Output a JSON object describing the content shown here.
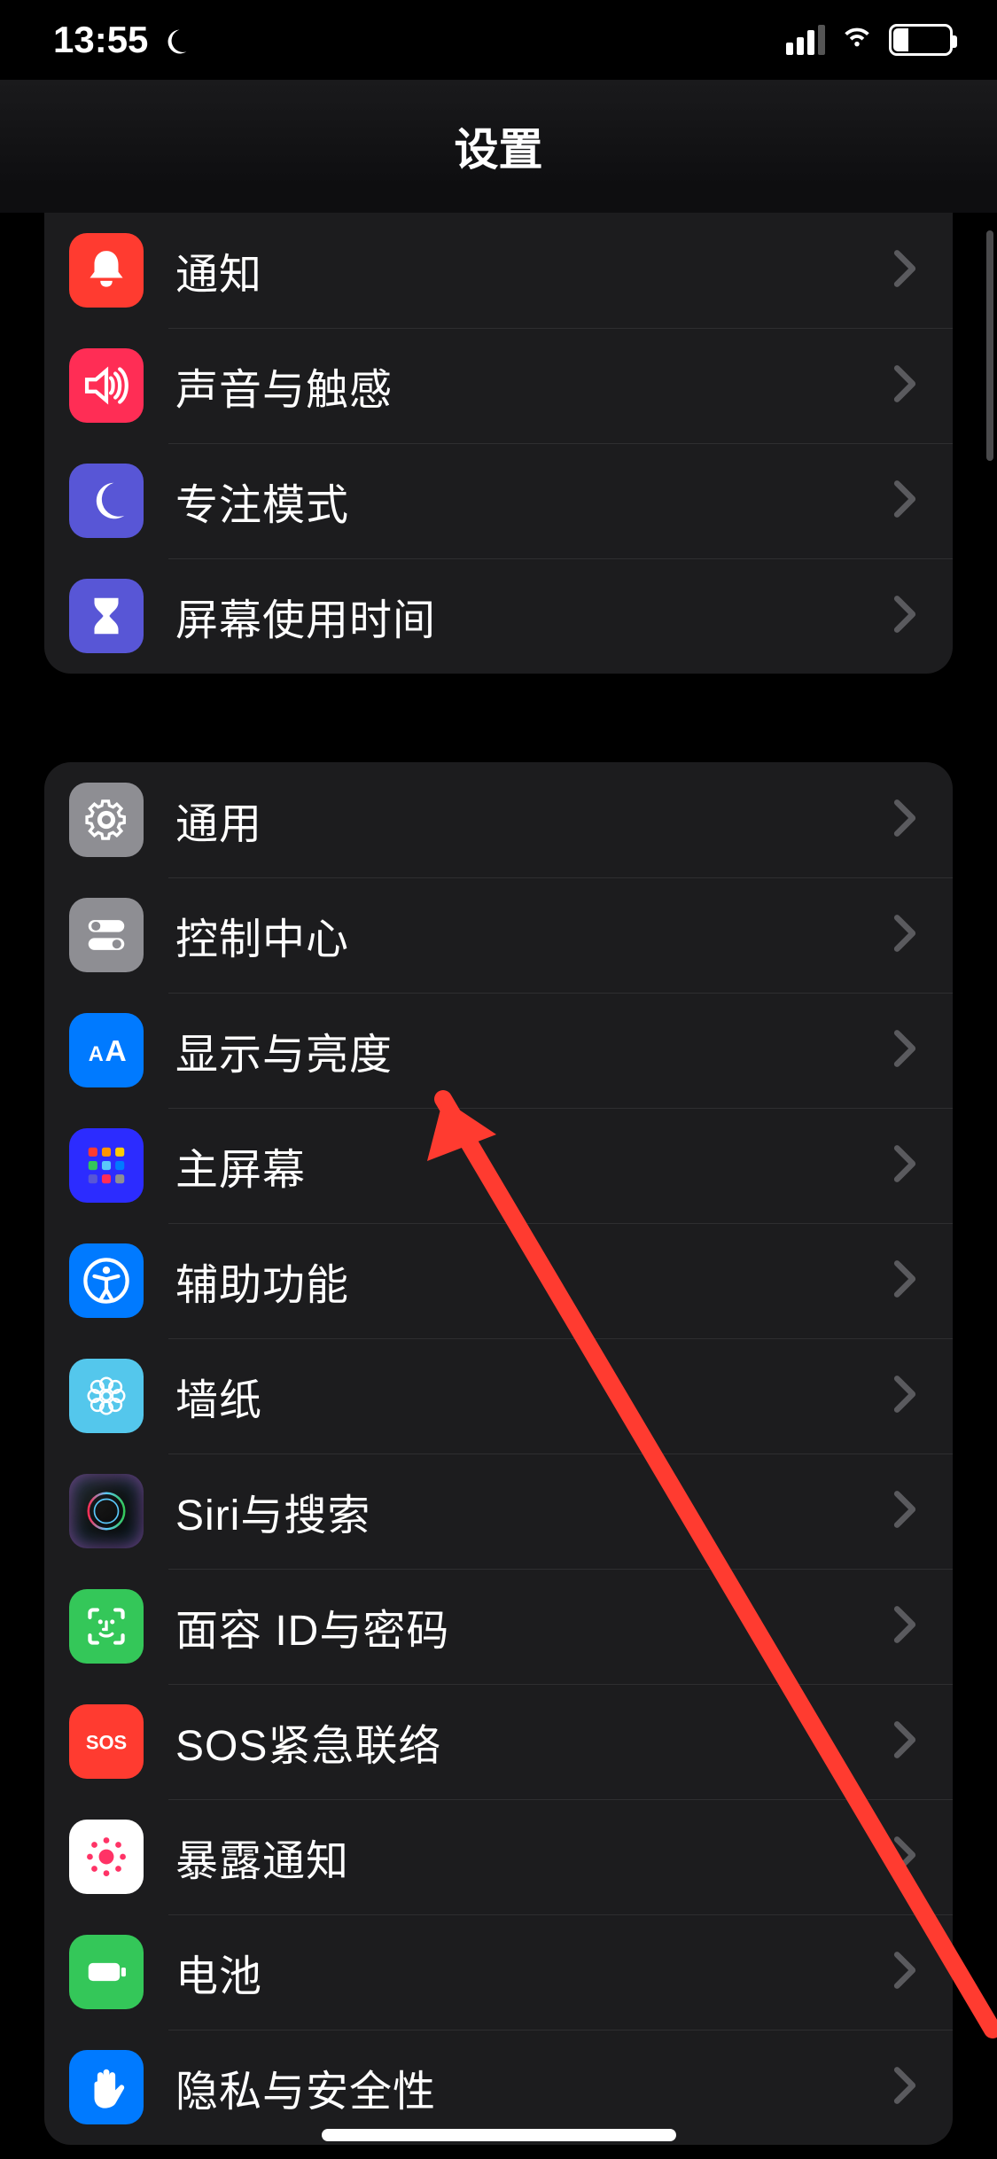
{
  "status": {
    "time": "13:55",
    "battery_pct": "27"
  },
  "nav": {
    "title": "设置"
  },
  "groups": [
    {
      "rows": [
        {
          "label": "通知",
          "icon": "bell-icon",
          "iconColor": "c-red"
        },
        {
          "label": "声音与触感",
          "icon": "speaker-icon",
          "iconColor": "c-pink"
        },
        {
          "label": "专注模式",
          "icon": "moon-icon",
          "iconColor": "c-indigo"
        },
        {
          "label": "屏幕使用时间",
          "icon": "hourglass-icon",
          "iconColor": "c-indigo"
        }
      ]
    },
    {
      "rows": [
        {
          "label": "通用",
          "icon": "gear-icon",
          "iconColor": "c-gray"
        },
        {
          "label": "控制中心",
          "icon": "switches-icon",
          "iconColor": "c-gray"
        },
        {
          "label": "显示与亮度",
          "icon": "textsize-icon",
          "iconColor": "c-blue"
        },
        {
          "label": "主屏幕",
          "icon": "apps-icon",
          "iconColor": "c-darkblue"
        },
        {
          "label": "辅助功能",
          "icon": "accessibility-icon",
          "iconColor": "c-blue"
        },
        {
          "label": "墙纸",
          "icon": "flower-icon",
          "iconColor": "c-teal"
        },
        {
          "label": "Siri与搜索",
          "icon": "siri-icon",
          "iconColor": "c-siri"
        },
        {
          "label": "面容 ID与密码",
          "icon": "faceid-icon",
          "iconColor": "c-green"
        },
        {
          "label": "SOS紧急联络",
          "icon": "sos-icon",
          "iconColor": "c-red"
        },
        {
          "label": "暴露通知",
          "icon": "exposure-icon",
          "iconColor": "c-white"
        },
        {
          "label": "电池",
          "icon": "battery-icon",
          "iconColor": "c-green"
        },
        {
          "label": "隐私与安全性",
          "icon": "hand-icon",
          "iconColor": "c-blue"
        }
      ]
    }
  ]
}
